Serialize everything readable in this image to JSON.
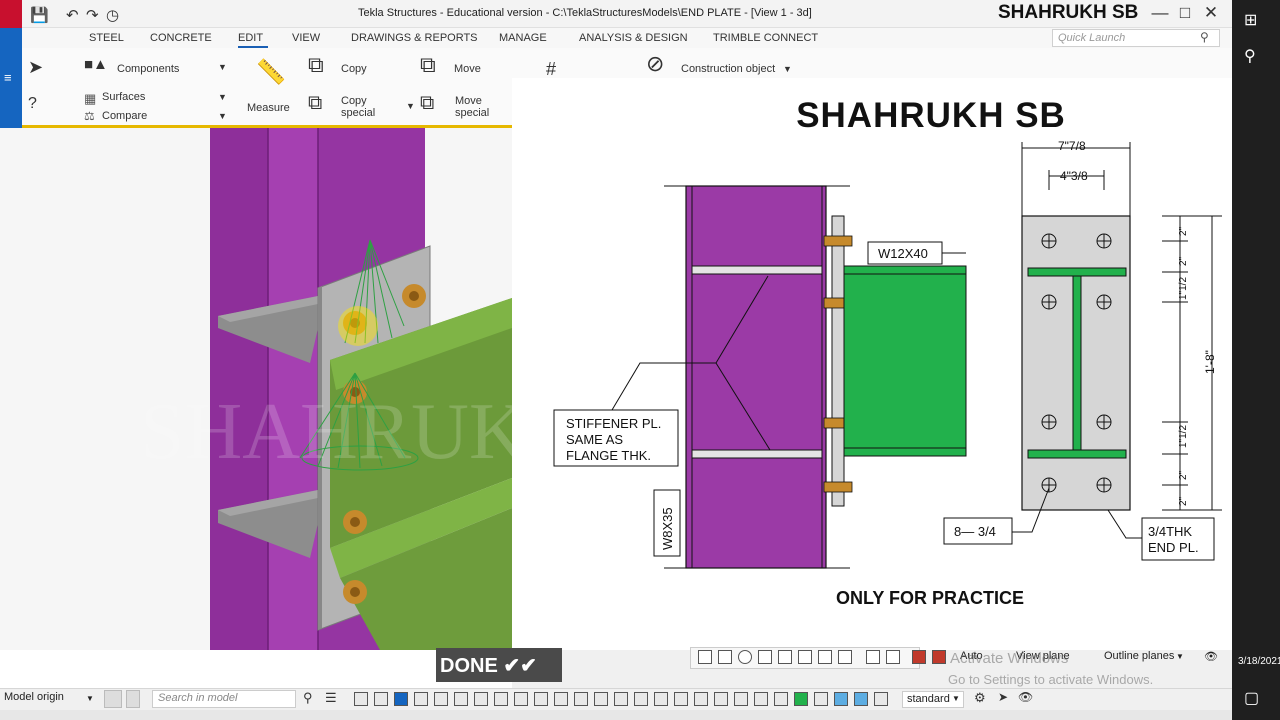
{
  "window": {
    "title": "Tekla Structures - Educational version - C:\\TeklaStructuresModels\\END PLATE - [View 1 - 3d]",
    "brand_overlay": "SHAHRUKH SB"
  },
  "menu": {
    "items": [
      "STEEL",
      "CONCRETE",
      "EDIT",
      "VIEW",
      "DRAWINGS & REPORTS",
      "MANAGE",
      "ANALYSIS & DESIGN",
      "TRIMBLE CONNECT"
    ],
    "active": "EDIT",
    "quick_launch_placeholder": "Quick Launch"
  },
  "ribbon": {
    "components": "Components",
    "surfaces": "Surfaces",
    "compare": "Compare",
    "measure": "Measure",
    "copy": "Copy",
    "copy_special": "Copy special",
    "move": "Move",
    "move_special": "Move special",
    "construction_object": "Construction object"
  },
  "drawing": {
    "title": "SHAHRUKH SB",
    "beam_label": "W12X40",
    "column_label": "W8X35",
    "stiffener_note": [
      "STIFFENER PL.",
      "SAME AS",
      "FLANGE THK."
    ],
    "dim_overall_width": "7\"7/8",
    "dim_gauge": "4\"3/8",
    "dim_height": "1'-8\"",
    "dim_bolt_spacing": [
      "2\"",
      "2\"",
      "1\"1/2",
      "1\"1/2",
      "2\"",
      "2\""
    ],
    "bolt_note": "8— 3/4",
    "plate_note": [
      "3/4THK",
      "END PL."
    ],
    "footer": "ONLY FOR PRACTICE"
  },
  "viewport": {
    "watermark": "SHAHRUKH SB"
  },
  "view_tools": {
    "auto": "Auto",
    "view_plane": "View plane",
    "outline_planes": "Outline planes"
  },
  "status": {
    "model_origin": "Model origin",
    "search_placeholder": "Search in model",
    "done_text": "DONE ✔✔",
    "standard": "standard"
  },
  "watermark_activate": {
    "line1": "Activate Windows",
    "line2": "Go to Settings to activate Windows."
  },
  "taskbar": {
    "date": "3/18/2021"
  },
  "colors": {
    "column": "#9b3aa6",
    "beam": "#22b14c",
    "plate": "#d6d6d6",
    "stiffener": "#e4e4e4",
    "ribbon_accent": "#e6b800",
    "left_strip": "#1565c0"
  }
}
